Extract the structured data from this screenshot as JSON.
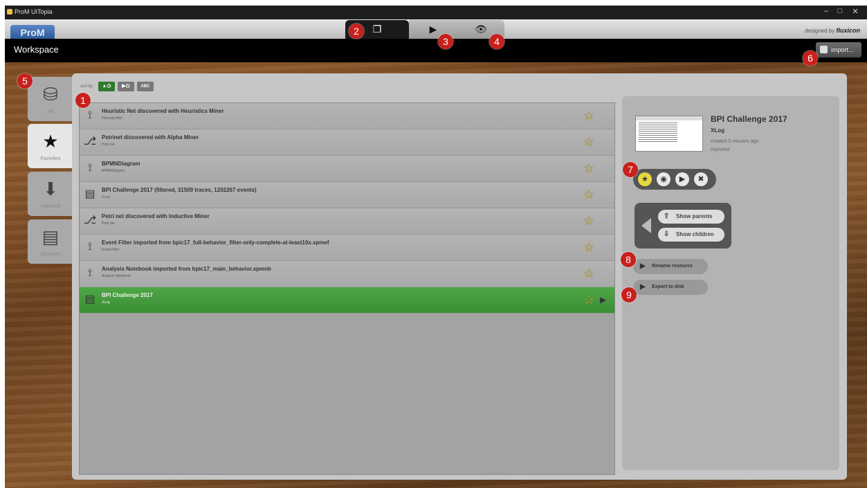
{
  "window": {
    "title": "ProM UITopia",
    "minimize": "–",
    "maximize": "□",
    "close": "✕"
  },
  "header": {
    "logo": "ProM",
    "brand_prefix": "designed by",
    "brand": "fluxicon",
    "tabs": [
      {
        "name": "workspace",
        "icon": "documents-icon",
        "glyph": "❐"
      },
      {
        "name": "actions",
        "icon": "play-icon",
        "glyph": "▶"
      },
      {
        "name": "views",
        "icon": "eye-icon",
        "glyph": "👁"
      }
    ]
  },
  "workspace_bar": {
    "title": "Workspace",
    "import_label": "import..."
  },
  "markers": [
    "1",
    "2",
    "3",
    "4",
    "5",
    "6",
    "7",
    "8",
    "9"
  ],
  "sidebar": {
    "items": [
      {
        "label": "All",
        "icon": "database-icon",
        "glyph": "⛁"
      },
      {
        "label": "Favorites",
        "icon": "star-icon",
        "glyph": "★"
      },
      {
        "label": "Imported",
        "icon": "import-icon",
        "glyph": "⬇"
      },
      {
        "label": "Selection",
        "icon": "selection-icon",
        "glyph": "▤"
      }
    ]
  },
  "sort": {
    "label": "sort by",
    "options": [
      {
        "label": "▲◷",
        "color": "#2f7a2b"
      },
      {
        "label": "▶◷",
        "color": "#777777"
      },
      {
        "label": "ABC",
        "color": "#777777"
      }
    ]
  },
  "resources": [
    {
      "title": "Heuristic Net discovered with Heuristics Miner",
      "type": "HeuristicsNet",
      "icon": "graph-icon",
      "glyph": "⟟",
      "selected": false
    },
    {
      "title": "Petrinet discovered with Alpha Miner",
      "type": "Petri net",
      "icon": "petri-net-icon",
      "glyph": "⎇",
      "selected": false
    },
    {
      "title": "BPMNDiagram",
      "type": "BPMNDiagram",
      "icon": "graph-icon",
      "glyph": "⟟",
      "selected": false
    },
    {
      "title": "BPI Challenge 2017 (filtered, 31509 traces, 1202267 events)",
      "type": "XLog",
      "icon": "document-icon",
      "glyph": "▤",
      "selected": false
    },
    {
      "title": "Petri net discovered with Inductive Miner",
      "type": "Petri net",
      "icon": "petri-net-icon",
      "glyph": "⎇",
      "selected": false
    },
    {
      "title": "Event Filter imported from bpic17_full-behavior_filter-only-complete-at-least10x.xpmef",
      "type": "Event Filter",
      "icon": "graph-icon",
      "glyph": "⟟",
      "selected": false
    },
    {
      "title": "Analysis Notebook imported from bpic17_main_behavior.xpmnb",
      "type": "Analysis Notebook",
      "icon": "graph-icon",
      "glyph": "⟟",
      "selected": false
    },
    {
      "title": "BPI Challenge 2017",
      "type": "XLog",
      "icon": "document-icon",
      "glyph": "▤",
      "selected": true
    }
  ],
  "detail": {
    "title": "BPI Challenge 2017",
    "type": "XLog",
    "created": "created 5 minutes ago",
    "origin": "imported",
    "actions": [
      {
        "icon": "star-icon",
        "glyph": "★"
      },
      {
        "icon": "eye-icon",
        "glyph": "◉"
      },
      {
        "icon": "play-icon",
        "glyph": "▶"
      },
      {
        "icon": "close-icon",
        "glyph": "✖"
      }
    ],
    "show_parents": "Show parents",
    "show_children": "Show children",
    "rename": "Rename resource",
    "export": "Export to disk"
  }
}
